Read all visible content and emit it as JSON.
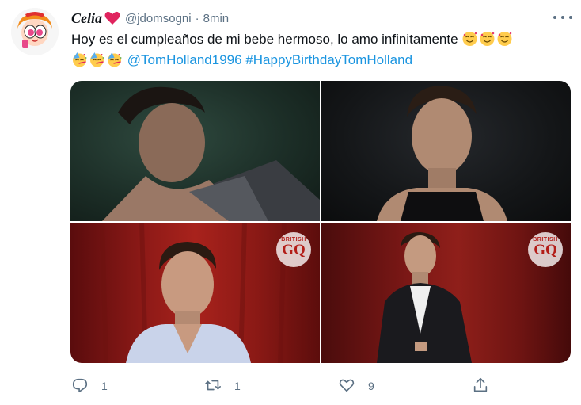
{
  "tweet": {
    "display_name": "Celia",
    "handle": "@jdomsogni",
    "separator": "·",
    "time": "8min",
    "text_main": "Hoy es el cumpleaños de mi bebe hermoso, lo amo infinitamente",
    "mention": "@TomHolland1996",
    "hashtag": "#HappyBirthdayTomHolland"
  },
  "media": {
    "badge_small": "BRITISH",
    "badge_big": "GQ"
  },
  "actions": {
    "reply_count": "1",
    "retweet_count": "1",
    "like_count": "9"
  },
  "colors": {
    "link": "#1b95e0",
    "secondary_text": "#5b7083",
    "heart": "#e0245e"
  },
  "icons": [
    "heart-emoji-icon",
    "smiling-hearts-emoji-icon",
    "party-face-emoji-icon",
    "more-icon",
    "reply-icon",
    "retweet-icon",
    "like-icon",
    "share-icon"
  ]
}
